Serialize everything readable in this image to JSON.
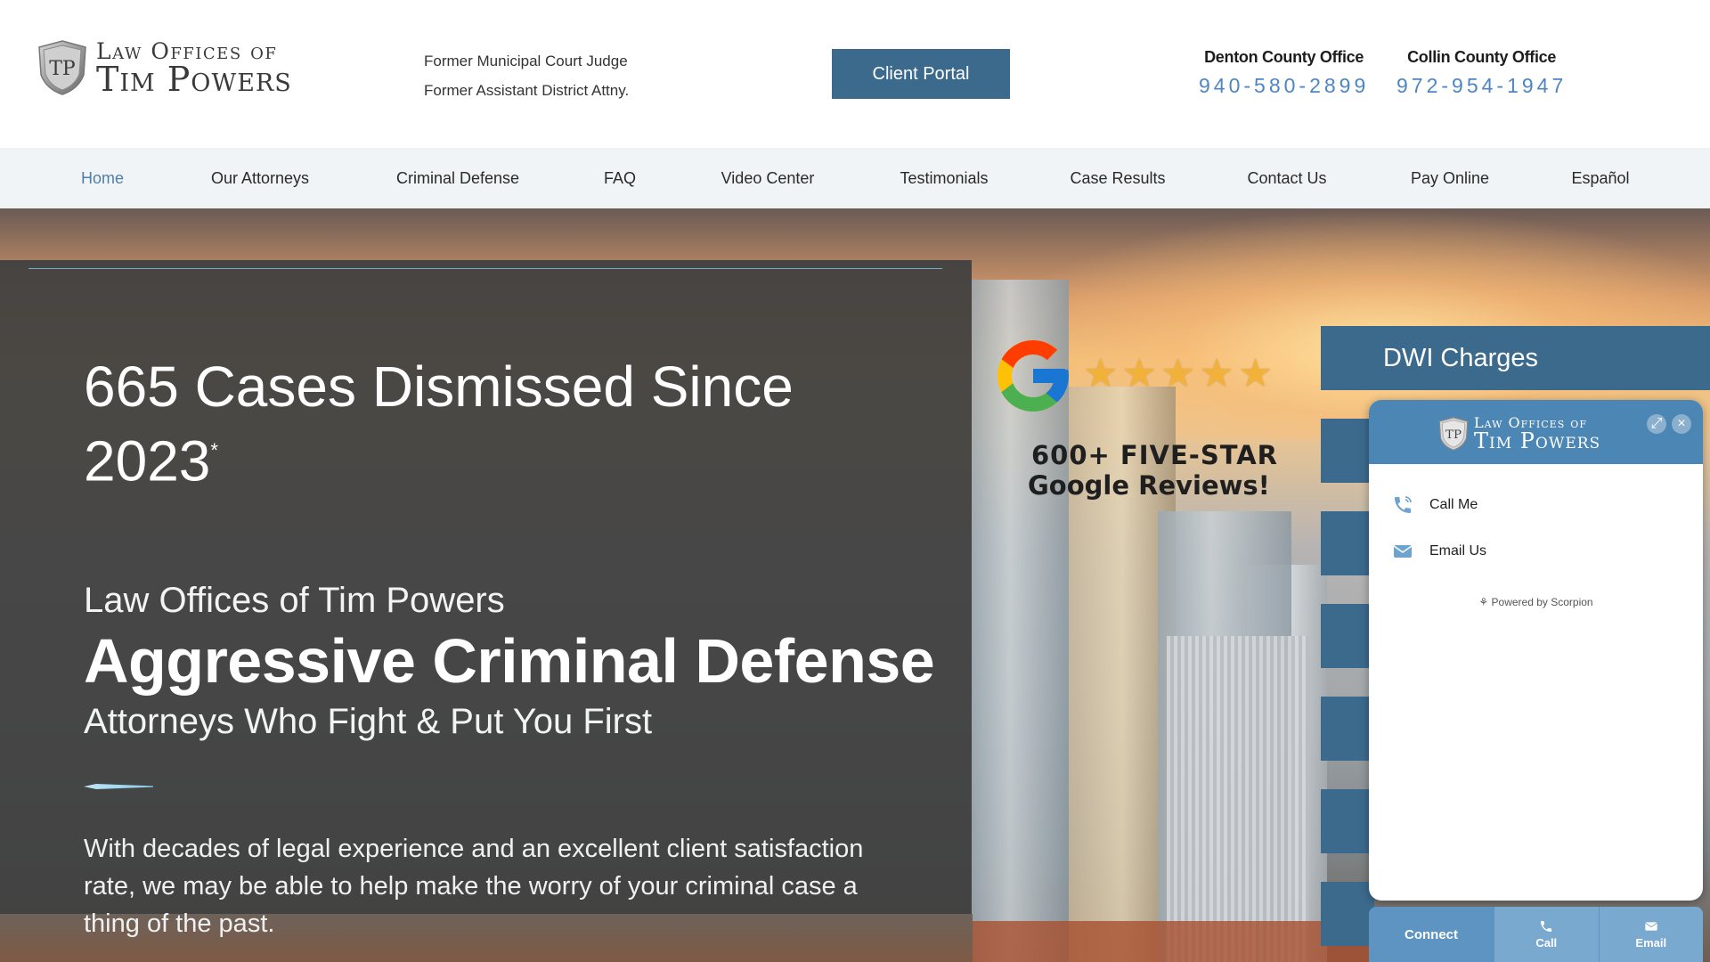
{
  "header": {
    "logo_line1": "Law Offices of",
    "logo_line2": "Tim Powers",
    "logo_initials": "TP",
    "tagline_line1": "Former Municipal Court Judge",
    "tagline_line2": "Former Assistant District Attny.",
    "client_portal_label": "Client Portal",
    "offices": [
      {
        "name": "Denton County Office",
        "phone": "940-580-2899"
      },
      {
        "name": "Collin County Office",
        "phone": "972-954-1947"
      }
    ]
  },
  "nav": {
    "items": [
      {
        "label": "Home",
        "active": true
      },
      {
        "label": "Our Attorneys"
      },
      {
        "label": "Criminal Defense"
      },
      {
        "label": "FAQ"
      },
      {
        "label": "Video Center"
      },
      {
        "label": "Testimonials"
      },
      {
        "label": "Case Results"
      },
      {
        "label": "Contact Us"
      },
      {
        "label": "Pay Online"
      },
      {
        "label": "Español"
      }
    ]
  },
  "hero": {
    "title": "665 Cases Dismissed Since 2023",
    "title_mark": "*",
    "firm_name": "Law Offices of Tim Powers",
    "headline": "Aggressive Criminal Defense",
    "subheadline": "Attorneys Who Fight & Put You First",
    "body": "With decades of legal experience and an excellent client satisfaction rate, we may be able to help make the worry of your criminal case a thing of the past."
  },
  "reviews": {
    "rating_stars": 5,
    "line1": "600+ FIVE-STAR",
    "line2": "Google Reviews!"
  },
  "practice_areas": {
    "first_label": "DWI Charges"
  },
  "widget": {
    "logo_line1": "Law Offices of",
    "logo_line2": "Tim Powers",
    "logo_initials": "TP",
    "call_me_label": "Call Me",
    "email_us_label": "Email Us",
    "powered_by": "Powered by Scorpion",
    "bar_connect_label": "Connect",
    "bar_call_label": "Call",
    "bar_email_label": "Email"
  },
  "colors": {
    "brand_blue": "#3c6a8d",
    "phone_blue": "#4f86c2",
    "widget_blue": "#4c86b4",
    "star_gold": "#f2b23a"
  }
}
